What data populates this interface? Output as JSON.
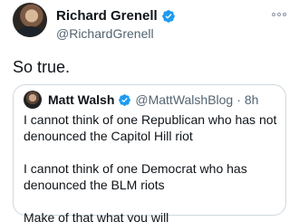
{
  "tweet": {
    "author_name": "Richard Grenell",
    "author_handle": "@RichardGrenell",
    "text": "So true.",
    "icons": {
      "verified": "verified-badge-icon",
      "more": "more-options-icon"
    },
    "colors": {
      "verified_blue": "#1d9bf0",
      "secondary_text": "#536471",
      "border": "#cfd9de"
    }
  },
  "quoted_tweet": {
    "author_name": "Matt Walsh",
    "author_handle": "@MattWalshBlog",
    "separator": "·",
    "time": "8h",
    "paragraphs": [
      "I cannot think of one Republican who has not denounced the Capitol Hill riot",
      "I cannot think of one Democrat who has denounced the BLM riots",
      "Make of that what you will"
    ]
  }
}
